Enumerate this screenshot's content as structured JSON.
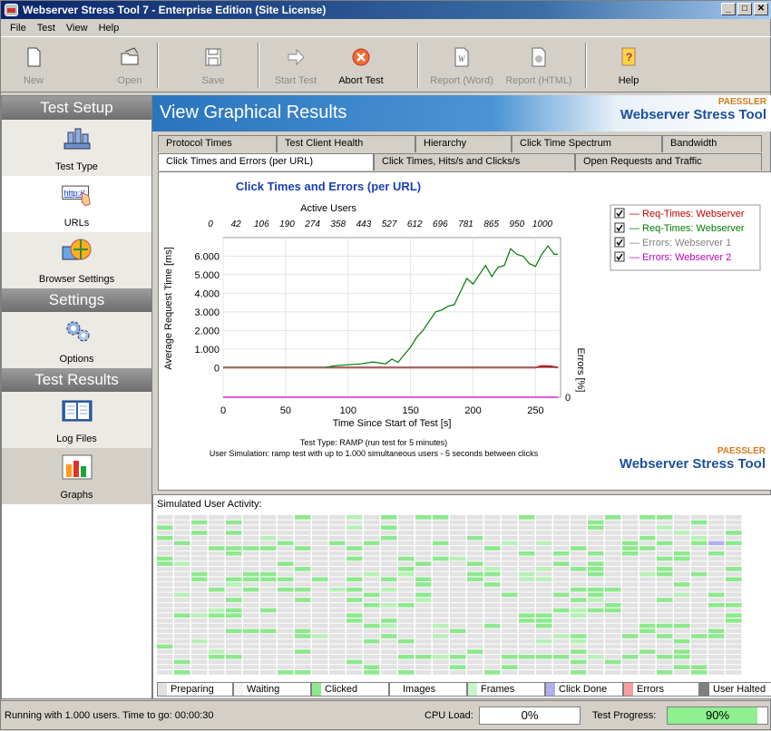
{
  "window": {
    "title": "Webserver Stress Tool 7 - Enterprise Edition (Site License)"
  },
  "menu": [
    "File",
    "Test",
    "View",
    "Help"
  ],
  "toolbar": {
    "new": "New",
    "open": "Open",
    "save": "Save",
    "start": "Start Test",
    "abort": "Abort Test",
    "report_word": "Report (Word)",
    "report_html": "Report (HTML)",
    "help": "Help"
  },
  "left": {
    "sections": [
      "Test Setup",
      "Settings",
      "Test Results"
    ],
    "items": [
      "Test Type",
      "URLs",
      "Browser Settings",
      "Options",
      "Log Files",
      "Graphs"
    ]
  },
  "banner": {
    "title": "View Graphical Results",
    "brand_small": "PAESSLER",
    "brand_big": "Webserver Stress Tool"
  },
  "tabs_row1": [
    "Protocol Times",
    "Test Client Health",
    "Hierarchy",
    "Click Time Spectrum",
    "Bandwidth"
  ],
  "tabs_row2": [
    "Click Times and Errors (per URL)",
    "Click Times, Hits/s and Clicks/s",
    "Open Requests and Traffic"
  ],
  "chart_data": {
    "type": "line",
    "title": "Click Times and Errors (per URL)",
    "xlabel": "Time Since Start of Test [s]",
    "ylabel": "Average Request Time [ms]",
    "y2label": "Errors [%]",
    "top_axis_label": "Active Users",
    "top_ticks": [
      "0",
      "42",
      "106",
      "190",
      "274",
      "358",
      "443",
      "527",
      "612",
      "696",
      "781",
      "865",
      "950",
      "1000"
    ],
    "xlim": [
      0,
      270
    ],
    "ylim": [
      -1600,
      7000
    ],
    "xticks": [
      0,
      50,
      100,
      150,
      200,
      250
    ],
    "yticks": [
      0,
      1000,
      2000,
      3000,
      4000,
      5000,
      6000
    ],
    "ytick_labels": [
      "0",
      "1.000",
      "2.000",
      "3.000",
      "4.000",
      "5.000",
      "6.000"
    ],
    "y2tick_label": "0",
    "footer1": "Test Type: RAMP (run test for 5 minutes)",
    "footer2": "User Simulation: ramp test with up to 1.000 simultaneous users - 5 seconds between clicks",
    "series": [
      {
        "name": "Req-Times: Webserver",
        "color": "#c00000",
        "points": [
          [
            0,
            0
          ],
          [
            75,
            0
          ],
          [
            100,
            0
          ],
          [
            150,
            0
          ],
          [
            200,
            0
          ],
          [
            250,
            0
          ],
          [
            255,
            80
          ],
          [
            262,
            60
          ],
          [
            268,
            0
          ]
        ]
      },
      {
        "name": "Req-Times: Webserver",
        "color": "#007a00",
        "points": [
          [
            0,
            0
          ],
          [
            80,
            0
          ],
          [
            90,
            100
          ],
          [
            100,
            150
          ],
          [
            110,
            200
          ],
          [
            120,
            300
          ],
          [
            130,
            200
          ],
          [
            135,
            450
          ],
          [
            140,
            280
          ],
          [
            145,
            700
          ],
          [
            150,
            1100
          ],
          [
            155,
            1650
          ],
          [
            160,
            2000
          ],
          [
            165,
            2500
          ],
          [
            170,
            3000
          ],
          [
            175,
            3100
          ],
          [
            180,
            3300
          ],
          [
            185,
            3400
          ],
          [
            190,
            4100
          ],
          [
            195,
            4800
          ],
          [
            200,
            4500
          ],
          [
            205,
            5000
          ],
          [
            210,
            5500
          ],
          [
            215,
            4900
          ],
          [
            220,
            5400
          ],
          [
            225,
            5500
          ],
          [
            230,
            6400
          ],
          [
            235,
            6100
          ],
          [
            240,
            6000
          ],
          [
            245,
            5600
          ],
          [
            250,
            5450
          ],
          [
            255,
            6100
          ],
          [
            260,
            6550
          ],
          [
            265,
            6100
          ],
          [
            268,
            6100
          ]
        ]
      },
      {
        "name": "Errors: Webserver 1",
        "color": "#808080",
        "points": [
          [
            0,
            0
          ],
          [
            268,
            0
          ]
        ]
      },
      {
        "name": "Errors: Webserver 2",
        "color": "#c000c0",
        "points": [
          [
            0,
            -1600
          ],
          [
            268,
            -1600
          ]
        ]
      }
    ]
  },
  "activity": {
    "title": "Simulated User Activity:",
    "legend": [
      "Preparing",
      "Waiting",
      "Clicked",
      "Images",
      "Frames",
      "Click Done",
      "Errors",
      "User Halted"
    ],
    "legend_colors": [
      "#e0e0e0",
      "#f4f4f4",
      "#8ee88e",
      "#ffffff",
      "#c8f5c8",
      "#b0b0f0",
      "#f4a0a0",
      "#808080"
    ]
  },
  "status": {
    "text": "Running with 1.000 users. Time to go: 00:00:30",
    "cpu_label": "CPU Load:",
    "cpu_value": "0%",
    "progress_label": "Test Progress:",
    "progress_value": "90%",
    "progress_fraction": 0.9
  }
}
